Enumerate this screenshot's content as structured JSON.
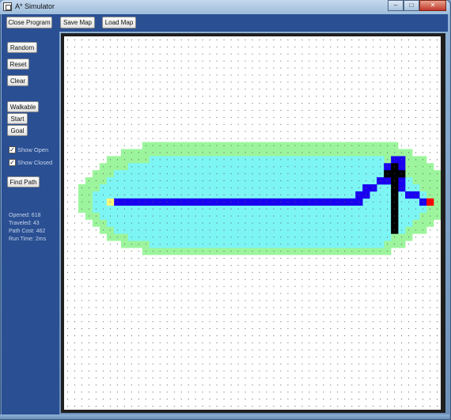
{
  "window": {
    "title": "A* Simulator",
    "minimize_label": "–",
    "maximize_label": "□",
    "close_label": "✕"
  },
  "toolbar": {
    "close_program": "Close Program",
    "save_map": "Save Map",
    "load_map": "Load Map"
  },
  "sidebar": {
    "random": "Random",
    "reset": "Reset",
    "clear": "Clear",
    "walkable": "Walkable",
    "start": "Start",
    "goal": "Goal",
    "show_open": {
      "label": "Show Open",
      "checked": true,
      "mark": "✓"
    },
    "show_closed": {
      "label": "Show Closed",
      "checked": true,
      "mark": "✓"
    },
    "find_path": "Find Path"
  },
  "stats": {
    "opened": "Opened: 618",
    "traveled": "Traveled: 43",
    "path_cost": "Path Cost: 462",
    "run_time": "Run Time: 2ms"
  },
  "grid": {
    "columns": 53,
    "rows": 53,
    "colors": {
      "background": "#ffffff",
      "dot": "#5a5a5a",
      "closed": "#7df5f5",
      "open": "#9cf59c",
      "path": "#1a00f0",
      "wall": "#000000",
      "start": "#f5f57a",
      "goal": "#ff0000"
    },
    "start_cell": [
      6,
      23
    ],
    "goal_cell": [
      51,
      23
    ],
    "wall_cells": [
      [
        46,
        18
      ],
      [
        46,
        19
      ],
      [
        46,
        20
      ],
      [
        46,
        21
      ],
      [
        46,
        22
      ],
      [
        46,
        23
      ],
      [
        46,
        24
      ],
      [
        46,
        25
      ],
      [
        46,
        26
      ],
      [
        46,
        27
      ],
      [
        47,
        19
      ],
      [
        45,
        19
      ]
    ],
    "path_cells": [
      [
        7,
        23
      ],
      [
        8,
        23
      ],
      [
        9,
        23
      ],
      [
        10,
        23
      ],
      [
        11,
        23
      ],
      [
        12,
        23
      ],
      [
        13,
        23
      ],
      [
        14,
        23
      ],
      [
        15,
        23
      ],
      [
        16,
        23
      ],
      [
        17,
        23
      ],
      [
        18,
        23
      ],
      [
        19,
        23
      ],
      [
        20,
        23
      ],
      [
        21,
        23
      ],
      [
        22,
        23
      ],
      [
        23,
        23
      ],
      [
        24,
        23
      ],
      [
        25,
        23
      ],
      [
        26,
        23
      ],
      [
        27,
        23
      ],
      [
        28,
        23
      ],
      [
        29,
        23
      ],
      [
        30,
        23
      ],
      [
        31,
        23
      ],
      [
        32,
        23
      ],
      [
        33,
        23
      ],
      [
        34,
        23
      ],
      [
        35,
        23
      ],
      [
        36,
        23
      ],
      [
        37,
        23
      ],
      [
        38,
        23
      ],
      [
        39,
        23
      ],
      [
        40,
        23
      ],
      [
        41,
        23
      ],
      [
        41,
        22
      ],
      [
        42,
        22
      ],
      [
        42,
        21
      ],
      [
        43,
        21
      ],
      [
        44,
        20
      ],
      [
        45,
        20
      ],
      [
        45,
        18
      ],
      [
        46,
        17
      ],
      [
        47,
        17
      ],
      [
        47,
        18
      ],
      [
        47,
        20
      ],
      [
        47,
        21
      ],
      [
        48,
        22
      ],
      [
        49,
        22
      ],
      [
        50,
        23
      ]
    ],
    "closed_region_rows": [
      {
        "row": 17,
        "from": 12,
        "to": 44
      },
      {
        "row": 18,
        "from": 9,
        "to": 45
      },
      {
        "row": 19,
        "from": 7,
        "to": 47
      },
      {
        "row": 20,
        "from": 6,
        "to": 48
      },
      {
        "row": 21,
        "from": 5,
        "to": 49
      },
      {
        "row": 22,
        "from": 4,
        "to": 50
      },
      {
        "row": 23,
        "from": 4,
        "to": 50
      },
      {
        "row": 24,
        "from": 4,
        "to": 50
      },
      {
        "row": 25,
        "from": 5,
        "to": 49
      },
      {
        "row": 26,
        "from": 6,
        "to": 48
      },
      {
        "row": 27,
        "from": 7,
        "to": 47
      },
      {
        "row": 28,
        "from": 9,
        "to": 45
      },
      {
        "row": 29,
        "from": 12,
        "to": 44
      }
    ],
    "open_border_rows": [
      {
        "row": 15,
        "from": 11,
        "to": 46
      },
      {
        "row": 16,
        "from": 8,
        "to": 48
      },
      {
        "row": 17,
        "from": 6,
        "to": 50
      },
      {
        "row": 18,
        "from": 5,
        "to": 51
      },
      {
        "row": 19,
        "from": 4,
        "to": 52
      },
      {
        "row": 20,
        "from": 3,
        "to": 52
      },
      {
        "row": 21,
        "from": 2,
        "to": 52
      },
      {
        "row": 22,
        "from": 2,
        "to": 52
      },
      {
        "row": 23,
        "from": 2,
        "to": 52
      },
      {
        "row": 24,
        "from": 2,
        "to": 52
      },
      {
        "row": 25,
        "from": 3,
        "to": 52
      },
      {
        "row": 26,
        "from": 4,
        "to": 51
      },
      {
        "row": 27,
        "from": 5,
        "to": 50
      },
      {
        "row": 28,
        "from": 6,
        "to": 48
      },
      {
        "row": 29,
        "from": 8,
        "to": 47
      },
      {
        "row": 30,
        "from": 11,
        "to": 45
      }
    ]
  }
}
